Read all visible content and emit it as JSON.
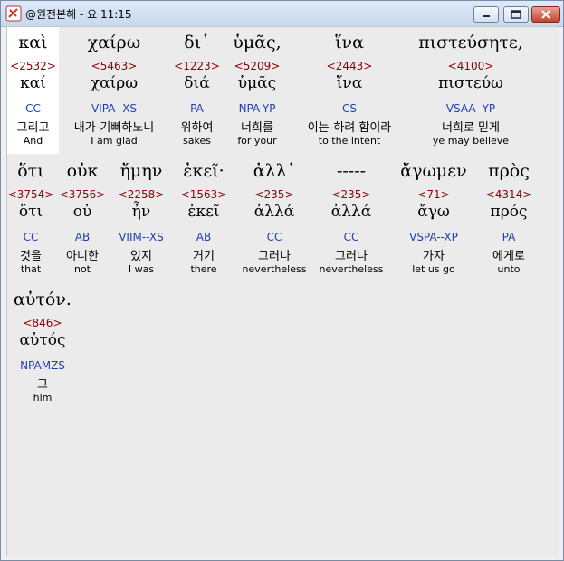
{
  "window": {
    "title": "@원전본해 - 요 11:15"
  },
  "colors": {
    "strong": "#8b0000",
    "parsing": "#1f3fb0"
  },
  "rows": [
    [
      {
        "greek": "καὶ",
        "strong": "<2532>",
        "lemma": "καί",
        "parsing": "CC",
        "korean": "그리고",
        "english": "And"
      },
      {
        "greek": "χαίρω",
        "strong": "<5463>",
        "lemma": "χαίρω",
        "parsing": "VIPA--XS",
        "korean": "내가-기뻐하노니",
        "english": "I am glad"
      },
      {
        "greek": "δι᾿",
        "strong": "<1223>",
        "lemma": "διά",
        "parsing": "PA",
        "korean": "위하여",
        "english": "sakes"
      },
      {
        "greek": "ὑμᾶς,",
        "strong": "<5209>",
        "lemma": "ὑμᾶς",
        "parsing": "NPA-YP",
        "korean": "너희를",
        "english": "for your"
      },
      {
        "greek": "ἵνα",
        "strong": "<2443>",
        "lemma": "ἵνα",
        "parsing": "CS",
        "korean": "이는-하려 함이라",
        "english": "to the intent"
      },
      {
        "greek": "πιστεύσητε,",
        "strong": "<4100>",
        "lemma": "πιστεύω",
        "parsing": "VSAA--YP",
        "korean": "너희로 믿게",
        "english": "ye may believe"
      }
    ],
    [
      {
        "greek": "ὅτι",
        "strong": "<3754>",
        "lemma": "ὅτι",
        "parsing": "CC",
        "korean": "것을",
        "english": "that"
      },
      {
        "greek": "οὐκ",
        "strong": "<3756>",
        "lemma": "οὐ",
        "parsing": "AB",
        "korean": "아니한",
        "english": "not"
      },
      {
        "greek": "ἤμην",
        "strong": "<2258>",
        "lemma": "ἦν",
        "parsing": "VIIM--XS",
        "korean": "있지",
        "english": "I was"
      },
      {
        "greek": "ἐκεῖ·",
        "strong": "<1563>",
        "lemma": "ἐκεῖ",
        "parsing": "AB",
        "korean": "거기",
        "english": "there"
      },
      {
        "greek": "ἀλλ᾿",
        "strong": "<235>",
        "lemma": "ἀλλά",
        "parsing": "CC",
        "korean": "그러나",
        "english": "nevertheless"
      },
      {
        "greek": "-----",
        "strong": "<235>",
        "lemma": "ἀλλά",
        "parsing": "CC",
        "korean": "그러나",
        "english": "nevertheless"
      },
      {
        "greek": "ἄγωμεν",
        "strong": "<71>",
        "lemma": "ἄγω",
        "parsing": "VSPA--XP",
        "korean": "가자",
        "english": "let us go"
      },
      {
        "greek": "πρὸς",
        "strong": "<4314>",
        "lemma": "πρός",
        "parsing": "PA",
        "korean": "에게로",
        "english": "unto"
      }
    ],
    [
      {
        "greek": "αὐτόν.",
        "strong": "<846>",
        "lemma": "αὐτός",
        "parsing": "NPAMZS",
        "korean": "그",
        "english": "him"
      }
    ]
  ]
}
